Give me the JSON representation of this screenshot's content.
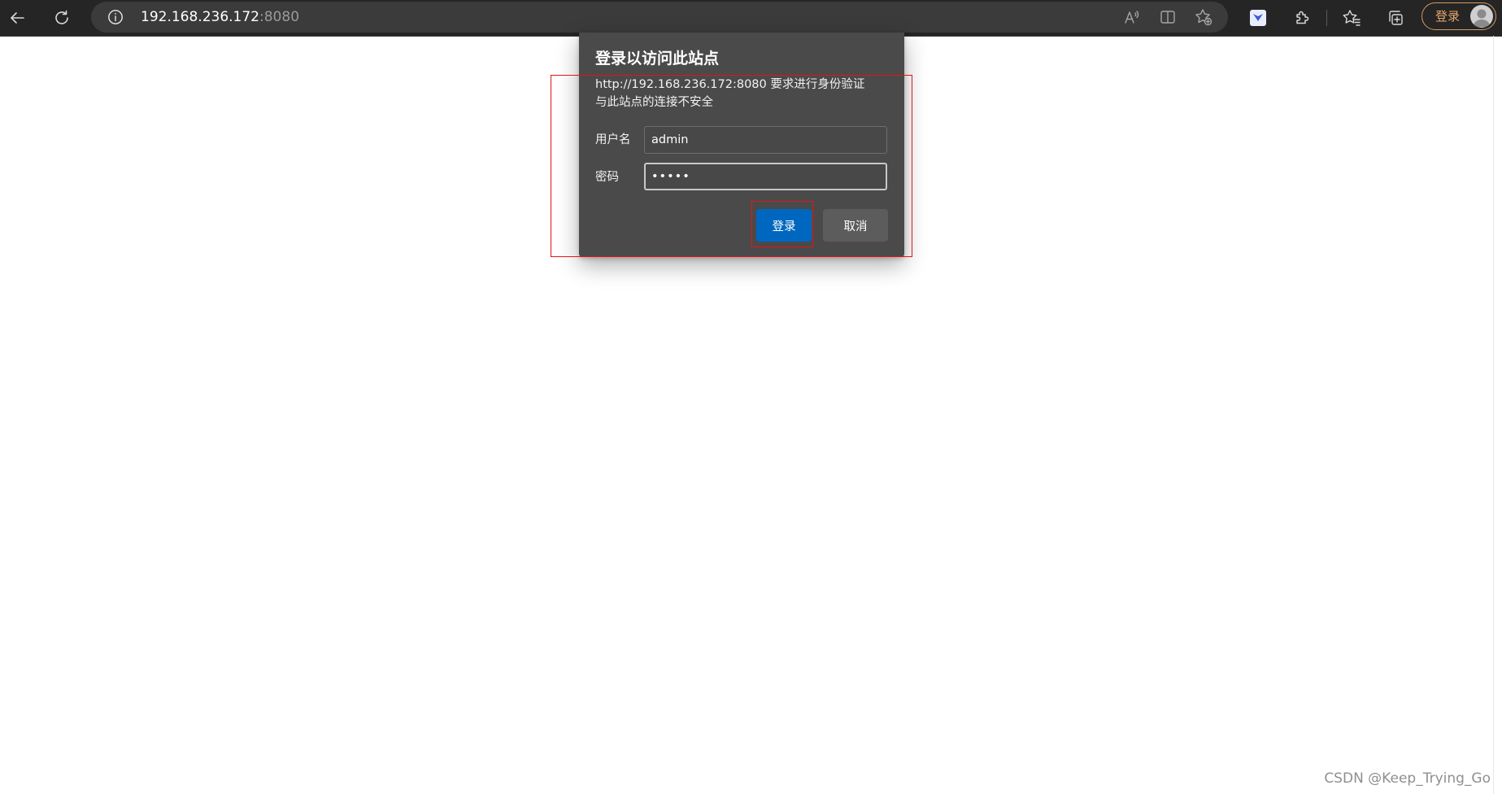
{
  "browser": {
    "url": {
      "host": "192.168.236.172",
      "port": ":8080"
    },
    "profile": {
      "label": "登录"
    },
    "icons": {
      "back": "back-arrow-icon",
      "refresh": "refresh-icon",
      "site_info": "info-icon",
      "read_aloud": "read-aloud-icon",
      "split_screen": "split-screen-icon",
      "add_favorite": "add-favorite-icon",
      "extension": "extension-app-icon",
      "extensions": "puzzle-icon",
      "favorites": "favorites-icon",
      "collections": "collections-icon",
      "avatar": "avatar-icon"
    }
  },
  "dialog": {
    "title": "登录以访问此站点",
    "message_line1": "http://192.168.236.172:8080 要求进行身份验证",
    "message_line2": "与此站点的连接不安全",
    "username_label": "用户名",
    "username_value": "admin",
    "password_label": "密码",
    "password_value": "•••••",
    "login_button": "登录",
    "cancel_button": "取消"
  },
  "watermark": {
    "text": "CSDN @Keep_Trying_Go"
  },
  "colors": {
    "toolbar_bg": "#252525",
    "dialog_bg": "#4a4a4a",
    "primary_button": "#0067c0",
    "annotation": "#e0161b"
  }
}
